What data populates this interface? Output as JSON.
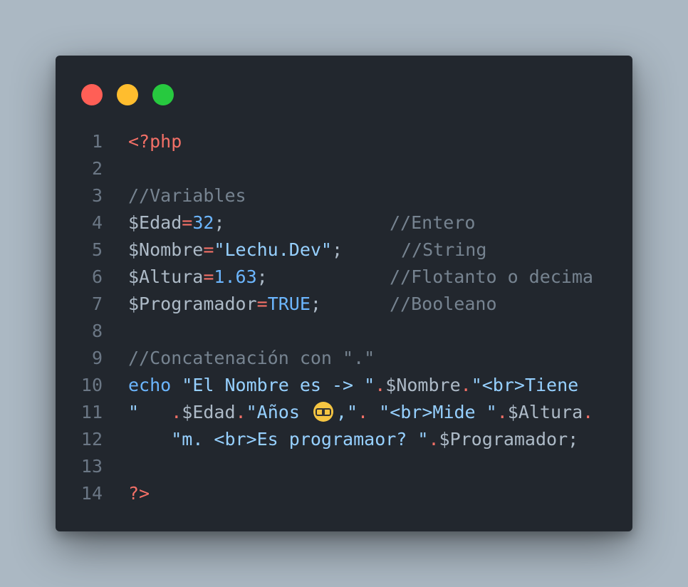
{
  "window_controls": {
    "close": "#ff5f56",
    "minimize": "#ffbd2e",
    "maximize": "#27c93f"
  },
  "lines": [
    {
      "n": "1",
      "tokens": [
        {
          "t": "<?php",
          "c": "kw-red"
        }
      ]
    },
    {
      "n": "2",
      "tokens": []
    },
    {
      "n": "3",
      "tokens": [
        {
          "t": "//Variables",
          "c": "cmt"
        }
      ]
    },
    {
      "n": "4",
      "tokens": [
        {
          "t": "$Edad",
          "c": "var"
        },
        {
          "t": "=",
          "c": "op"
        },
        {
          "t": "32",
          "c": "num"
        },
        {
          "t": ";",
          "c": "plain"
        }
      ],
      "comment": "//Entero"
    },
    {
      "n": "5",
      "tokens": [
        {
          "t": "$Nombre",
          "c": "var"
        },
        {
          "t": "=",
          "c": "op"
        },
        {
          "t": "\"Lechu.Dev\"",
          "c": "str"
        },
        {
          "t": ";",
          "c": "plain"
        }
      ],
      "comment": "//String"
    },
    {
      "n": "6",
      "tokens": [
        {
          "t": "$Altura",
          "c": "var"
        },
        {
          "t": "=",
          "c": "op"
        },
        {
          "t": "1.63",
          "c": "num"
        },
        {
          "t": ";",
          "c": "plain"
        }
      ],
      "comment": "//Flotanto o decima"
    },
    {
      "n": "7",
      "tokens": [
        {
          "t": "$Programador",
          "c": "var"
        },
        {
          "t": "=",
          "c": "op"
        },
        {
          "t": "TRUE",
          "c": "const"
        },
        {
          "t": ";",
          "c": "plain"
        }
      ],
      "comment": "//Booleano"
    },
    {
      "n": "8",
      "tokens": []
    },
    {
      "n": "9",
      "tokens": [
        {
          "t": "//Concatenación con \".\"",
          "c": "cmt"
        }
      ]
    },
    {
      "n": "10",
      "tokens": [
        {
          "t": "echo",
          "c": "func"
        },
        {
          "t": " ",
          "c": "plain"
        },
        {
          "t": "\"El Nombre es -> \"",
          "c": "str"
        },
        {
          "t": ".",
          "c": "op"
        },
        {
          "t": "$Nombre",
          "c": "var"
        },
        {
          "t": ".",
          "c": "op"
        },
        {
          "t": "\"<br>Tiene",
          "c": "str"
        }
      ]
    },
    {
      "n": "11",
      "tokens": [
        {
          "t": "\"   ",
          "c": "str"
        },
        {
          "t": ".",
          "c": "op"
        },
        {
          "t": "$Edad",
          "c": "var"
        },
        {
          "t": ".",
          "c": "op"
        },
        {
          "t": "\"Años ",
          "c": "str"
        },
        {
          "t": "",
          "c": "emoji"
        },
        {
          "t": ",\"",
          "c": "str"
        },
        {
          "t": ". ",
          "c": "op"
        },
        {
          "t": "\"<br>Mide \"",
          "c": "str"
        },
        {
          "t": ".",
          "c": "op"
        },
        {
          "t": "$Altura",
          "c": "var"
        },
        {
          "t": ".",
          "c": "op"
        }
      ]
    },
    {
      "n": "12",
      "tokens": [
        {
          "t": "    ",
          "c": "plain"
        },
        {
          "t": "\"m. <br>Es programaor? \"",
          "c": "str"
        },
        {
          "t": ".",
          "c": "op"
        },
        {
          "t": "$Programador",
          "c": "var"
        },
        {
          "t": ";",
          "c": "plain"
        }
      ]
    },
    {
      "n": "13",
      "tokens": []
    },
    {
      "n": "14",
      "tokens": [
        {
          "t": "?>",
          "c": "kw-red"
        }
      ]
    }
  ],
  "comment_columns": {
    "4": 469,
    "5": 485,
    "6": 469,
    "7": 469
  }
}
